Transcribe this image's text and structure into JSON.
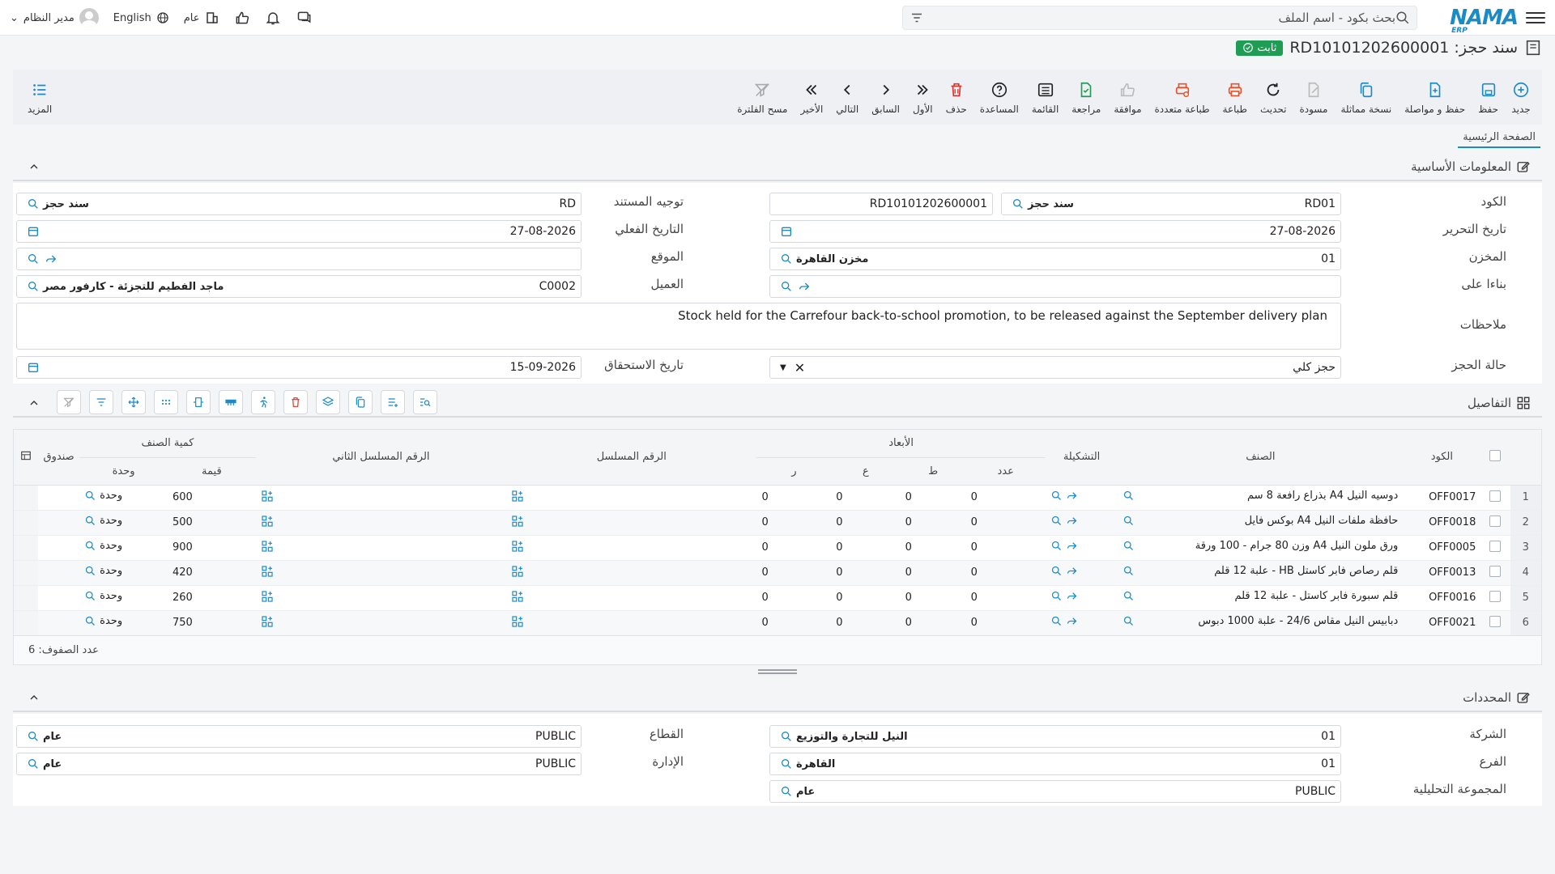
{
  "topbar": {
    "search_placeholder": "بحث بكود - اسم الملف",
    "user_name": "مدير النظام",
    "language": "English",
    "scope": "عام"
  },
  "document": {
    "title": "سند حجز: RD10101202600001",
    "status": "ثابت"
  },
  "toolbar": {
    "buttons": [
      "جديد",
      "حفظ",
      "حفظ و مواصلة",
      "نسخة مماثلة",
      "مسودة",
      "تحديث",
      "طباعة",
      "طباعة متعددة",
      "موافقة",
      "مراجعة",
      "القائمة",
      "المساعدة",
      "حذف",
      "الأول",
      "السابق",
      "التالي",
      "الأخير",
      "مسح الفلترة"
    ],
    "more": "المزيد"
  },
  "tabs": {
    "main": "الصفحة الرئيسية"
  },
  "basic": {
    "title": "المعلومات الأساسية",
    "code_label": "الكود",
    "code_value": "RD01",
    "code_desc": "سند حجز",
    "doc_number": "RD10101202600001",
    "direction_label": "توجيه المستند",
    "direction_value": "RD",
    "direction_desc": "سند حجز",
    "edit_date_label": "تاريخ التحرير",
    "edit_date": "27-08-2026",
    "actual_date_label": "التاريخ الفعلي",
    "actual_date": "27-08-2026",
    "warehouse_label": "المخزن",
    "warehouse_code": "01",
    "warehouse_desc": "مخزن القاهرة",
    "location_label": "الموقع",
    "based_on_label": "بناءا على",
    "customer_label": "العميل",
    "customer_code": "C0002",
    "customer_desc": "ماجد الفطيم للتجزئة - كارفور مصر",
    "notes_label": "ملاحظات",
    "notes": "Stock held for the Carrefour back-to-school promotion, to be released against the September delivery plan",
    "status_label": "حالة الحجز",
    "status_value": "حجز كلي",
    "due_date_label": "تاريخ الاستحقاق",
    "due_date": "15-09-2026"
  },
  "details": {
    "title": "التفاصيل",
    "headers": {
      "code": "الكود",
      "item": "الصنف",
      "config": "التشكيلة",
      "dimensions": "الأبعاد",
      "count": "عدد",
      "t": "ط",
      "a": "ع",
      "r": "ر",
      "serial": "الرقم المسلسل",
      "serial2": "الرقم المسلسل الثاني",
      "qty_group": "كمية الصنف",
      "value": "قيمة",
      "unit": "وحدة",
      "box": "صندوق"
    },
    "rows": [
      {
        "n": "1",
        "code": "OFF0017",
        "item": "دوسيه النيل A4 بذراع رافعة 8 سم",
        "count": "0",
        "t": "0",
        "a": "0",
        "r": "0",
        "value": "600",
        "unit": "وحدة"
      },
      {
        "n": "2",
        "code": "OFF0018",
        "item": "حافظة ملفات النيل A4 بوكس فايل",
        "count": "0",
        "t": "0",
        "a": "0",
        "r": "0",
        "value": "500",
        "unit": "وحدة"
      },
      {
        "n": "3",
        "code": "OFF0005",
        "item": "ورق ملون النيل A4 وزن 80 جرام - 100 ورقة",
        "count": "0",
        "t": "0",
        "a": "0",
        "r": "0",
        "value": "900",
        "unit": "وحدة"
      },
      {
        "n": "4",
        "code": "OFF0013",
        "item": "قلم رصاص فابر كاستل HB - علبة 12 قلم",
        "count": "0",
        "t": "0",
        "a": "0",
        "r": "0",
        "value": "420",
        "unit": "وحدة"
      },
      {
        "n": "5",
        "code": "OFF0016",
        "item": "قلم سبورة فابر كاستل - علبة 12 قلم",
        "count": "0",
        "t": "0",
        "a": "0",
        "r": "0",
        "value": "260",
        "unit": "وحدة"
      },
      {
        "n": "6",
        "code": "OFF0021",
        "item": "دبابيس النيل مقاس 24/6 - علبة 1000 دبوس",
        "count": "0",
        "t": "0",
        "a": "0",
        "r": "0",
        "value": "750",
        "unit": "وحدة"
      }
    ],
    "row_count": "عدد الصفوف: 6"
  },
  "dims": {
    "title": "المحددات",
    "company_label": "الشركة",
    "company_code": "01",
    "company_desc": "النيل للتجارة والتوزيع",
    "branch_label": "الفرع",
    "branch_code": "01",
    "branch_desc": "القاهرة",
    "group_label": "المجموعة التحليلية",
    "group_code": "PUBLIC",
    "group_desc": "عام",
    "sector_label": "القطاع",
    "sector_code": "PUBLIC",
    "sector_desc": "عام",
    "dept_label": "الإدارة",
    "dept_code": "PUBLIC",
    "dept_desc": "عام"
  }
}
